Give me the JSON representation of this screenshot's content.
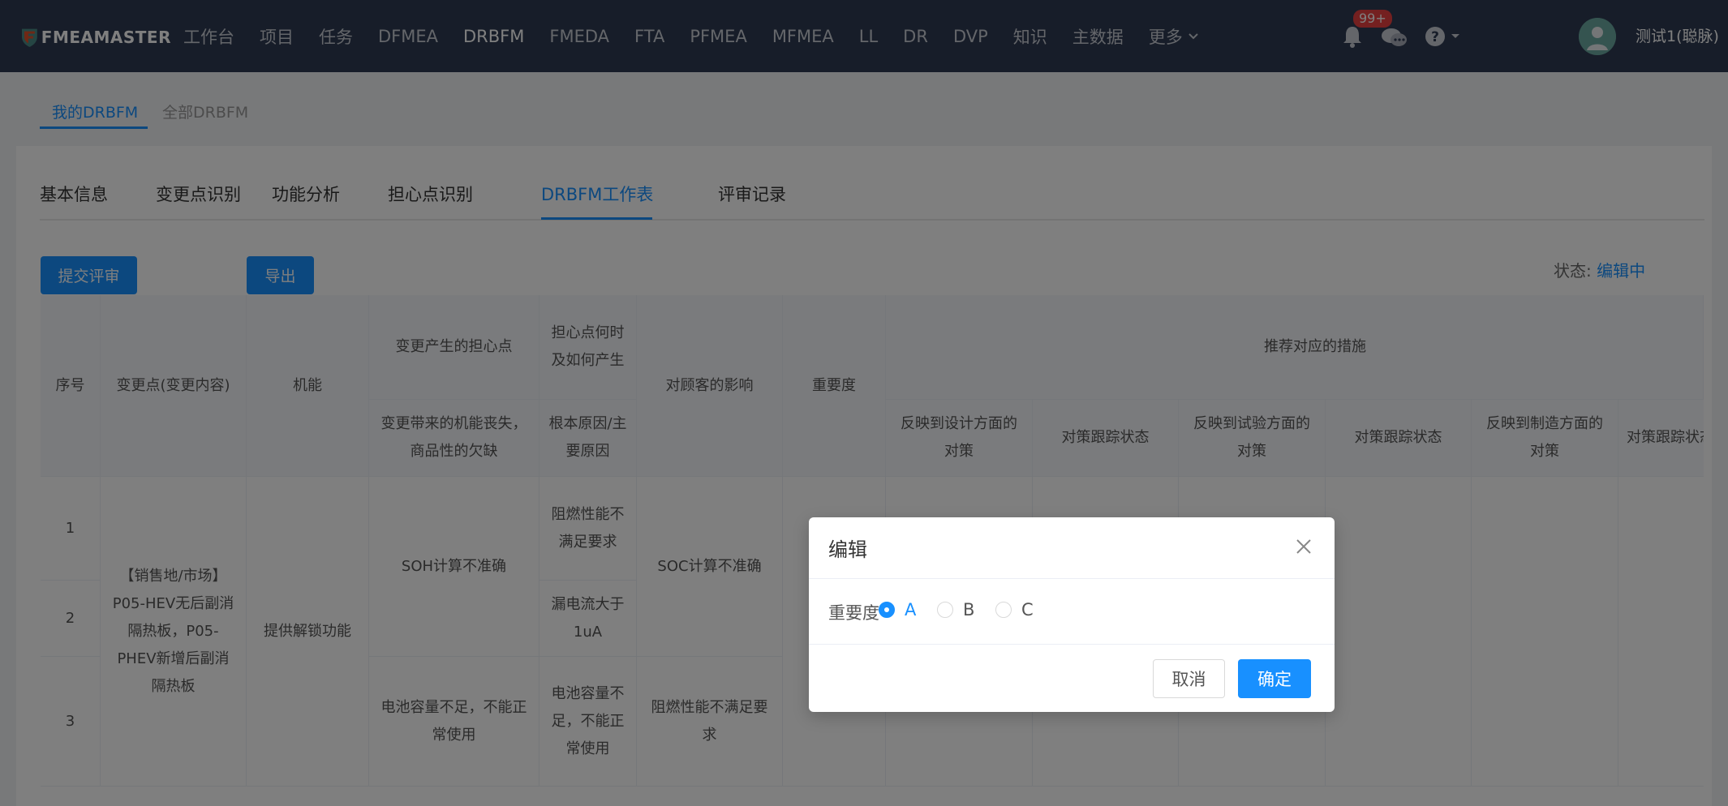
{
  "brand": {
    "name": "FMEAMASTER"
  },
  "nav": {
    "items": [
      "工作台",
      "项目",
      "任务",
      "DFMEA",
      "DRBFM",
      "FMEDA",
      "FTA",
      "PFMEA",
      "MFMEA",
      "LL",
      "DR",
      "DVP",
      "知识",
      "主数据"
    ],
    "active_index": 4,
    "more_label": "更多"
  },
  "header": {
    "notification_badge": "99+",
    "user_name": "测试1(聪脉)"
  },
  "subtabs": [
    "我的DRBFM",
    "全部DRBFM"
  ],
  "tabs": [
    "基本信息",
    "变更点识别",
    "功能分析",
    "担心点识别",
    "DRBFM工作表",
    "评审记录"
  ],
  "toolbar": {
    "submit_label": "提交评审",
    "export_label": "导出"
  },
  "status": {
    "label": "状态:",
    "value": "编辑中"
  },
  "table": {
    "headers": {
      "seq": "序号",
      "change": "变更点(变更内容)",
      "function": "机能",
      "concern": "变更产生的担心点",
      "when_how": "担心点何时及如何产生",
      "impact": "对顾客的影响",
      "importance": "重要度",
      "measures": "推荐对应的措施",
      "concern_sub": "变更带来的机能丧失，商品性的欠缺",
      "root_cause": "根本原因/主要原因",
      "design_measure": "反映到设计方面的对策",
      "tracking1": "对策跟踪状态",
      "test_measure": "反映到试验方面的对策",
      "tracking2": "对策跟踪状态",
      "mfg_measure": "反映到制造方面的对策",
      "tracking3": "对策跟踪状态"
    },
    "rows": {
      "seq": [
        "1",
        "2",
        "3"
      ],
      "change_text": "【销售地/市场】P05-HEV无后副消隔热板，P05-PHEV新增后副消隔热板",
      "function_text": "提供解锁功能",
      "concern_1": "SOH计算不准确",
      "concern_2": "电池容量不足，不能正常使用",
      "cause_1": "阻燃性能不满足要求",
      "cause_2": "漏电流大于1uA",
      "cause_3": "电池容量不足，不能正常使用",
      "impact_1": "SOC计算不准确",
      "impact_2": "阻燃性能不满足要求"
    }
  },
  "modal": {
    "title": "编辑",
    "field_label": "重要度",
    "options": [
      "A",
      "B",
      "C"
    ],
    "selected": "A",
    "cancel_label": "取消",
    "ok_label": "确定"
  }
}
